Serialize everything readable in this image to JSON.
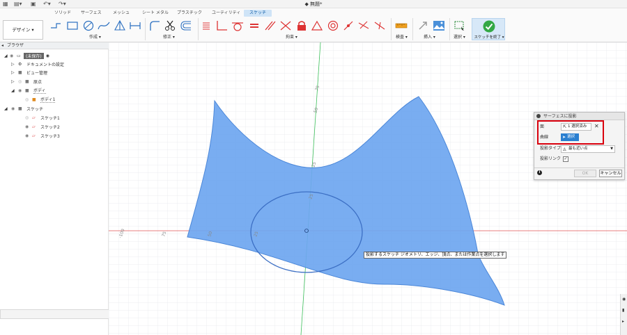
{
  "window": {
    "title": "無題*"
  },
  "ribbon": {
    "tabs": [
      "ソリッド",
      "サーフェス",
      "メッシュ",
      "シート メタル",
      "プラスチック",
      "ユーティリティ",
      "スケッチ"
    ],
    "active_tab_index": 6,
    "design_label": "デザイン ▾",
    "groups": {
      "create": "作成 ▾",
      "modify": "修正 ▾",
      "constraints": "拘束 ▾",
      "inspect": "検査 ▾",
      "insert": "挿入 ▾",
      "select": "選択 ▾",
      "finish": "スケッチを終了 ▾"
    }
  },
  "browser": {
    "title": "ブラウザ",
    "items": [
      {
        "label": "(未保存)",
        "level": 0
      },
      {
        "label": "ドキュメントの設定",
        "level": 1
      },
      {
        "label": "ビュー管理",
        "level": 1
      },
      {
        "label": "原点",
        "level": 1
      },
      {
        "label": "ボディ",
        "level": 1
      },
      {
        "label": "ボディ1",
        "level": 2
      },
      {
        "label": "スケッチ",
        "level": 1
      },
      {
        "label": "スケッチ1",
        "level": 2
      },
      {
        "label": "スケッチ2",
        "level": 2
      },
      {
        "label": "スケッチ3",
        "level": 2
      }
    ]
  },
  "canvas": {
    "tooltip": "投影するスケッチ ジオメトリ、エッジ、頂点、または作業点を選択します",
    "axis_labels": {
      "x": [
        "-100",
        "75",
        "50",
        "25"
      ],
      "y": [
        "75",
        "50",
        "25",
        "25"
      ]
    }
  },
  "dialog": {
    "title": "サーフェスに投影",
    "face_label": "面",
    "face_value": "1 選択済み",
    "curve_label": "曲線",
    "curve_button": "選択",
    "type_label": "投影タイプ",
    "type_value": "最も近い点",
    "link_label": "投影リンク",
    "link_checked": "✓",
    "ok": "OK",
    "cancel": "キャンセル",
    "info": "i"
  },
  "colors": {
    "surface": "#6ea6f0",
    "surface_edge": "#4a86d8",
    "x_axis": "#e05050",
    "y_axis": "#3cbf5a",
    "grid": "#e4e6ea",
    "accent": "#2a7fd0",
    "highlight": "#d9000d"
  }
}
